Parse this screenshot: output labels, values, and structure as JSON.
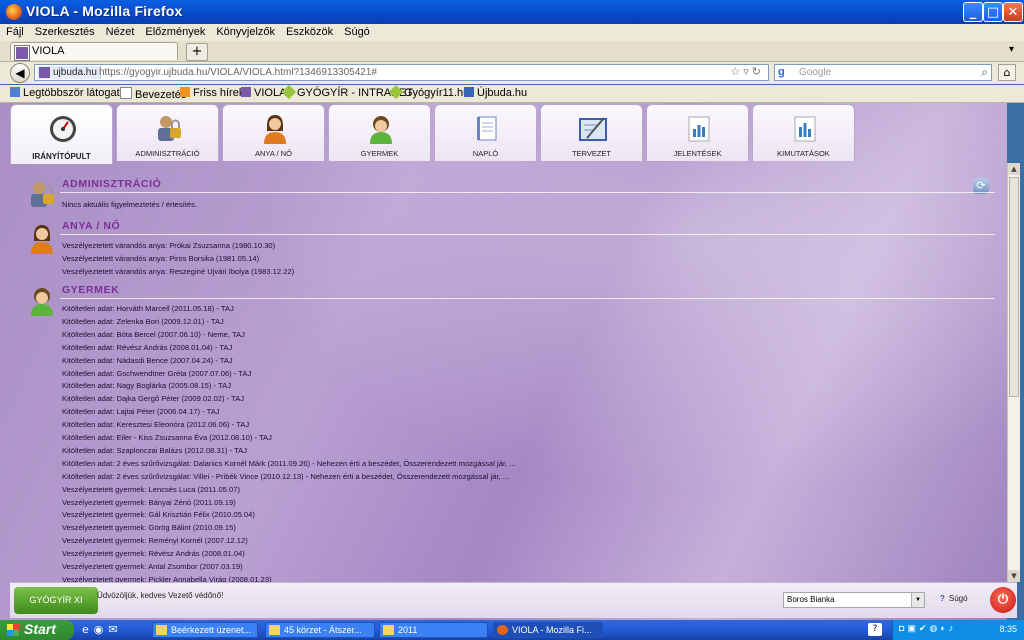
{
  "window": {
    "title": "VIOLA - Mozilla Firefox",
    "min": "_",
    "max": "□",
    "close": "✕"
  },
  "menu": [
    "Fájl",
    "Szerkesztés",
    "Nézet",
    "Előzmények",
    "Könyvjelzők",
    "Eszközök",
    "Súgó"
  ],
  "browser_tab": {
    "title": "VIOLA",
    "new_tab": "+"
  },
  "address": {
    "site": "ujbuda.hu",
    "url": "https://gyogyir.ujbuda.hu/VIOLA/VIOLA.html?1346913305421#",
    "search_placeholder": "Google"
  },
  "bookmarks": [
    "Legtöbbször látogatott",
    "Bevezetés",
    "Friss hírek",
    "VIOLA",
    "GYÓGYÍR - INTRANET",
    "Gyógyír11.hu",
    "Újbuda.hu"
  ],
  "app_tabs": [
    "IRÁNYÍTÓPULT",
    "ADMINISZTRÁCIÓ",
    "ANYA / NŐ",
    "GYERMEK",
    "NAPLÓ",
    "TERVEZET",
    "JELENTÉSEK",
    "KIMUTATÁSOK"
  ],
  "sections": {
    "admin": {
      "title": "ADMINISZTRÁCIÓ",
      "rows": [
        "Nincs aktuális figyelmeztetés / értesítés."
      ]
    },
    "anya": {
      "title": "ANYA / NŐ",
      "rows": [
        "Veszélyeztetett várandós anya: Prókai Zsuzsanna (1980.10.30)",
        "Veszélyeztetett várandós anya: Piros Borsika (1981.05.14)",
        "Veszélyeztetett várandós anya: Reszeginé Ujvári Ibolya (1983.12.22)"
      ]
    },
    "gyermek": {
      "title": "GYERMEK",
      "rows": [
        "Kitöltetlen adat: Horváth Marcell (2011.05.18) - TAJ",
        "Kitöltetlen adat: Zelenka Bori (2009.12.01) - TAJ",
        "Kitöltetlen adat: Bóta Bercel (2007.06.10) - Neme, TAJ",
        "Kitöltetlen adat: Révész András (2008.01.04) - TAJ",
        "Kitöltetlen adat: Nádasdi Bence (2007.04.24) - TAJ",
        "Kitöltetlen adat: Gschwendtner Gréta (2007.07.06) - TAJ",
        "Kitöltetlen adat: Nagy Boglárka (2005.08.15) - TAJ",
        "Kitöltetlen adat: Dajka Gergő Péter (2009.02.02) - TAJ",
        "Kitöltetlen adat: Lajtai Péter (2006.04.17) - TAJ",
        "Kitöltetlen adat: Keresztesi Eleonóra (2012.06.06) - TAJ",
        "Kitöltetlen adat: Eiler - Kiss Zsuzsanna Éva (2012.08.10) - TAJ",
        "Kitöltetlen adat: Szaplonczai Balázs (2012.08.31) - TAJ",
        "Kitöltetlen adat: 2 éves szűrővizsgálat: Dalanics Kornél Márk (2011.09.26) - Nehezen érti a beszédet, Összerendezett mozgással jár, ...",
        "Kitöltetlen adat: 2 éves szűrővizsgálat: Villei - Pribék Vince (2010.12.13) - Nehezen érti a beszédet, Összerendezett mozgással jár, ...",
        "Veszélyeztetett gyermek: Lencsés Luca (2011.05.07)",
        "Veszélyeztetett gyermek: Bányai Zénó (2011.09.19)",
        "Veszélyeztetett gyermek: Gál Krisztián Félix (2010.05.04)",
        "Veszélyeztetett gyermek: Görög Bálint (2010.09.15)",
        "Veszélyeztetett gyermek: Reményi Kornél (2007.12.12)",
        "Veszélyeztetett gyermek: Révész András (2008.01.04)",
        "Veszélyeztetett gyermek: Antal Zsombor (2007.03.19)",
        "Veszélyeztetett gyermek: Pickler Annabella Virág (2008.01.23)"
      ]
    }
  },
  "footer": {
    "logo": "GYÓGYÍR XI",
    "welcome": "Üdvözöljük, kedves Vezető védőnő!",
    "user": "Boros Bianka",
    "help": "Súgó"
  },
  "taskbar": {
    "start": "Start",
    "buttons": [
      "Beérkezett üzenet...",
      "45 körzet - Átszer...",
      "2011",
      "VIOLA - Mozilla Fi..."
    ],
    "clock": "8:35"
  }
}
